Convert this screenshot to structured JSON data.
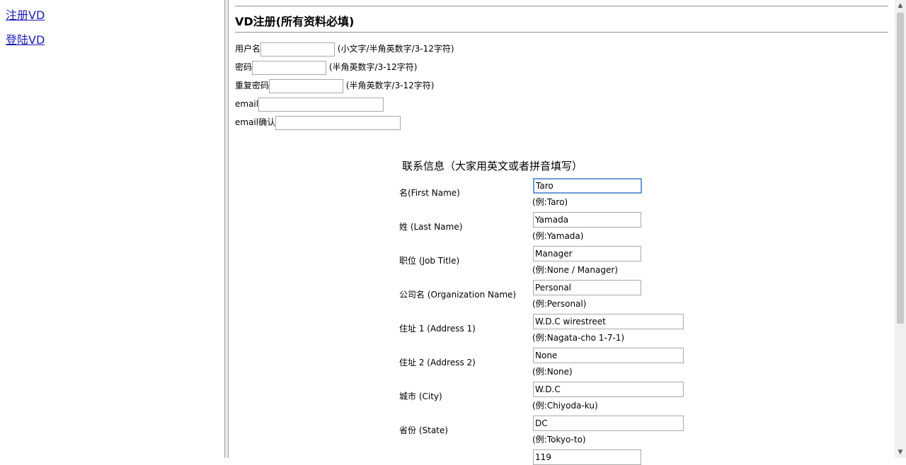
{
  "nav": {
    "register_link": "注册VD",
    "login_link": "登陆VD"
  },
  "page": {
    "title": "VD注册(所有资料必填)"
  },
  "account_fields": [
    {
      "label": "用户名",
      "hint": "(小文字/半角英数字/3-12字符)"
    },
    {
      "label": "密码",
      "hint": "(半角英数字/3-12字符)"
    },
    {
      "label": "重复密码",
      "hint": "(半角英数字/3-12字符)"
    },
    {
      "label": "email"
    },
    {
      "label": "email确认"
    }
  ],
  "contact": {
    "title": "联系信息（大家用英文或者拼音填写）",
    "fields": [
      {
        "label": "名(First Name)",
        "value": "Taro",
        "example": "(例:Taro)"
      },
      {
        "label": "姓 (Last Name)",
        "value": "Yamada",
        "example": "(例:Yamada)"
      },
      {
        "label": "职位 (Job Title)",
        "value": "Manager",
        "example": "(例:None / Manager)"
      },
      {
        "label": "公司名 (Organization Name)",
        "value": "Personal",
        "example": "(例:Personal)"
      },
      {
        "label": "住址 1 (Address 1)",
        "value": "W.D.C wirestreet",
        "example": "(例:Nagata-cho 1-7-1)"
      },
      {
        "label": "住址 2 (Address 2)",
        "value": "None",
        "example": "(例:None)"
      },
      {
        "label": "城市 (City)",
        "value": "W.D.C",
        "example": "(例:Chiyoda-ku)"
      },
      {
        "label": "省份 (State)",
        "value": "DC",
        "example": "(例:Tokyo-to)"
      },
      {
        "label": "",
        "value": "119",
        "example": ""
      }
    ]
  }
}
